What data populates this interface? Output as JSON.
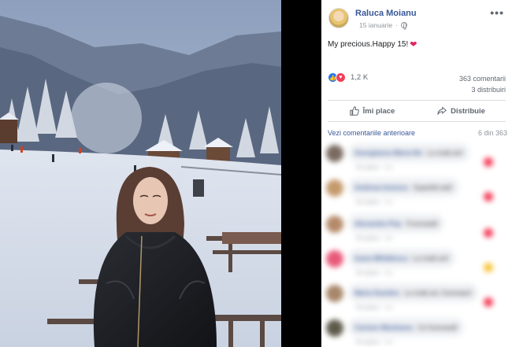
{
  "post": {
    "author": "Raluca Moianu",
    "date": "15 ianuarie",
    "message": "My precious.Happy 15!",
    "reactions_count": "1,2 K",
    "comments_count": "363 comentarii",
    "shares_count": "3 distribuiri",
    "like_label": "Îmi place",
    "share_label": "Distribuie",
    "view_comments_label": "Vezi comentariile anterioare",
    "comments_position": "6 din 363"
  },
  "icons": {
    "avatar": "user-avatar",
    "privacy": "globe-icon",
    "more": "more-options-icon",
    "message_emoji": "red-heart-icon",
    "reactions": [
      "like-reaction-icon",
      "love-reaction-icon"
    ],
    "like_button": "thumbs-up-icon",
    "share_button": "share-arrow-icon"
  },
  "colors": {
    "link_blue": "#385898",
    "like_blue": "#2078f4",
    "love_red": "#f33e58",
    "heart_red": "#e0245e",
    "muted_text": "#606770"
  },
  "comments": [
    {
      "name": "Georgianna Maria Ilie",
      "text": "La mulți ani!",
      "meta": "Îmi place · 3 z"
    },
    {
      "name": "Andreea Ionescu",
      "text": "Superbă ești!",
      "meta": "Îmi place · 3 z"
    },
    {
      "name": "Alexandra Pop",
      "text": "Frumoasă!",
      "meta": "Îmi place · 3 z"
    },
    {
      "name": "Ioana Mihăilescu",
      "text": "La mulți ani!",
      "meta": "Îmi place · 3 z"
    },
    {
      "name": "Maria Dumitru",
      "text": "La mulți ani, frumoaso!",
      "meta": "Îmi place · 3 z"
    },
    {
      "name": "Carmen Munteanu",
      "text": "Ce frumoasă!",
      "meta": "Îmi place · 3 z"
    }
  ]
}
